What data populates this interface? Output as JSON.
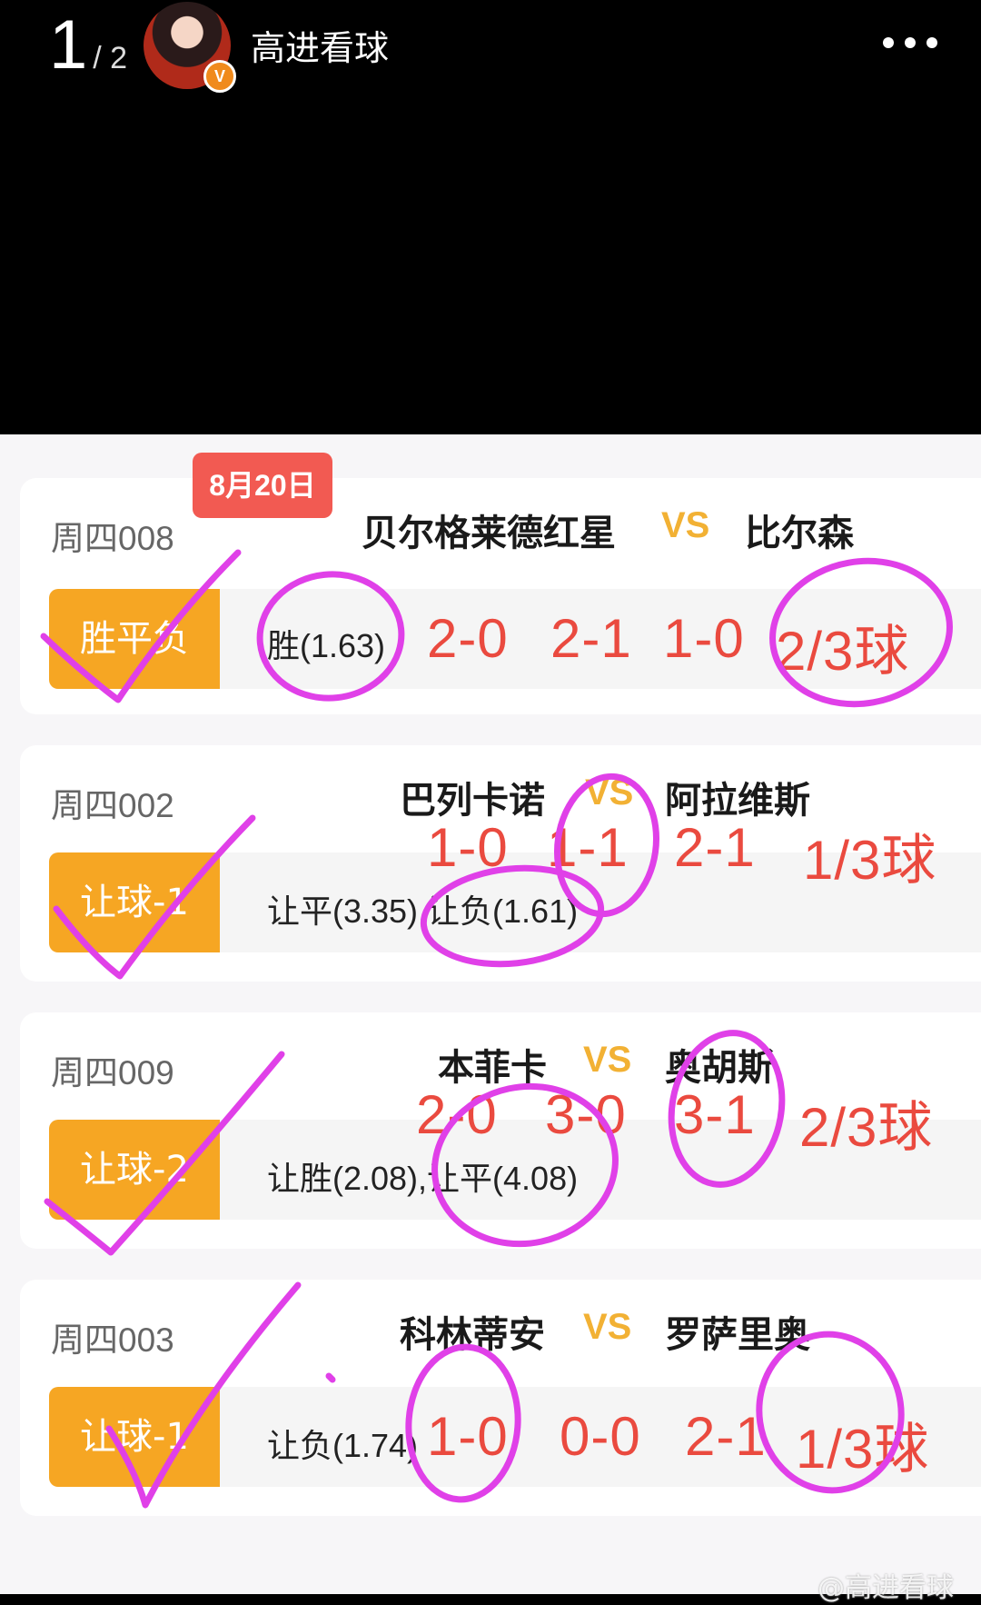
{
  "viewer": {
    "current_page": "1",
    "total_pages": "/ 2",
    "username": "高进看球",
    "verified_badge": "V"
  },
  "date_tag": "8月20日",
  "matches": [
    {
      "code": "周四008",
      "home": "贝尔格莱德红星",
      "vs": "VS",
      "away": "比尔森",
      "play_type": "胜平负",
      "bet": "胜(1.63)",
      "scores": [
        "2-0",
        "2-1",
        "1-0",
        "2/3球"
      ]
    },
    {
      "code": "周四002",
      "home": "巴列卡诺",
      "vs": "VS",
      "away": "阿拉维斯",
      "play_type": "让球-1",
      "bet": "让平(3.35),让负(1.61)",
      "scores": [
        "1-0",
        "1-1",
        "2-1",
        "1/3球"
      ]
    },
    {
      "code": "周四009",
      "home": "本菲卡",
      "vs": "VS",
      "away": "奥胡斯",
      "play_type": "让球-2",
      "bet": "让胜(2.08),让平(4.08)",
      "scores": [
        "2-0",
        "3-0",
        "3-1",
        "2/3球"
      ]
    },
    {
      "code": "周四003",
      "home": "科林蒂安",
      "vs": "VS",
      "away": "罗萨里奥",
      "play_type": "让球-1",
      "bet": "让负(1.74)",
      "scores": [
        "1-0",
        "0-0",
        "2-1",
        "1/3球"
      ]
    }
  ],
  "watermark": "@高进看球",
  "colors": {
    "accent_orange": "#f6a623",
    "score_red": "#ea4a3f",
    "vs_yellow": "#f2b134",
    "annotation_magenta": "#e040e8",
    "date_tag_red": "#f25a52"
  }
}
